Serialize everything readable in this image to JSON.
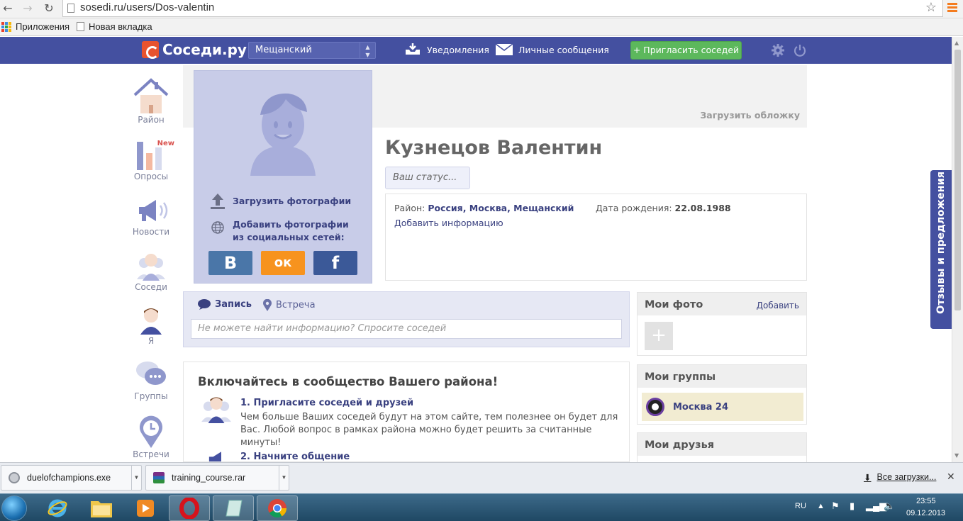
{
  "browser": {
    "url": "sosedi.ru/users/Dos-valentin",
    "bookmarks": [
      {
        "label": "Приложения"
      },
      {
        "label": "Новая вкладка"
      }
    ]
  },
  "header": {
    "logo_text": "Соседи.ру",
    "district_value": "Мещанский",
    "notifications_label": "Уведомления",
    "messages_label": "Личные сообщения",
    "invite_label": "+ Пригласить соседей"
  },
  "left_nav": {
    "items": [
      {
        "label": "Район",
        "icon": "house-icon"
      },
      {
        "label": "Опросы",
        "icon": "bar-chart-icon"
      },
      {
        "label": "Новости",
        "icon": "megaphone-icon"
      },
      {
        "label": "Соседи",
        "icon": "neighbors-icon"
      },
      {
        "label": "Я",
        "icon": "user-icon"
      },
      {
        "label": "Группы",
        "icon": "chat-bubbles-icon"
      },
      {
        "label": "Встречи",
        "icon": "clock-pin-icon"
      }
    ],
    "new_badge": "New"
  },
  "profile": {
    "cover_link": "Загрузить обложку",
    "upload_photos": "Загрузить фотографии",
    "add_social_line1": "Добавить фотографии",
    "add_social_line2": "из социальных сетей:",
    "social": {
      "vk": "В",
      "ok": "ок",
      "fb": "f"
    },
    "name": "Кузнецов Валентин",
    "status_placeholder": "Ваш статус...",
    "district_label": "Район:",
    "district_value": "Россия, Москва, Мещанский",
    "birth_label": "Дата рождения:",
    "birth_value": "22.08.1988",
    "add_info": "Добавить информацию"
  },
  "post": {
    "tab_post": "Запись",
    "tab_meeting": "Встреча",
    "input_placeholder": "Не можете найти информацию? Спросите соседей"
  },
  "welcome": {
    "title": "Включайтесь в сообщество Вашего района!",
    "steps": [
      {
        "title": "1. Пригласите соседей и друзей",
        "text": "Чем больше Ваших соседей будут на этом сайте, тем полезнее он будет для Вас. Любой вопрос в рамках района можно будет решить за считанные минуты!"
      },
      {
        "title": "2. Начните общение",
        "text": ""
      }
    ]
  },
  "sidebar": {
    "photos_title": "Мои фото",
    "photos_add": "Добавить",
    "groups_title": "Мои группы",
    "group_name": "Москва 24",
    "friends_title": "Мои друзья"
  },
  "feedback_tab": "Отзывы и предложения",
  "downloads": {
    "items": [
      {
        "name": "duelofchampions.exe"
      },
      {
        "name": "training_course.rar"
      }
    ],
    "all_label": "Все загрузки..."
  },
  "taskbar": {
    "lang": "RU",
    "time": "23:55",
    "date": "09.12.2013"
  },
  "colors": {
    "brand": "#4450a0",
    "accent_green": "#5cb85c",
    "vk": "#4a76a8",
    "ok": "#f7931e",
    "fb": "#3b5998"
  }
}
